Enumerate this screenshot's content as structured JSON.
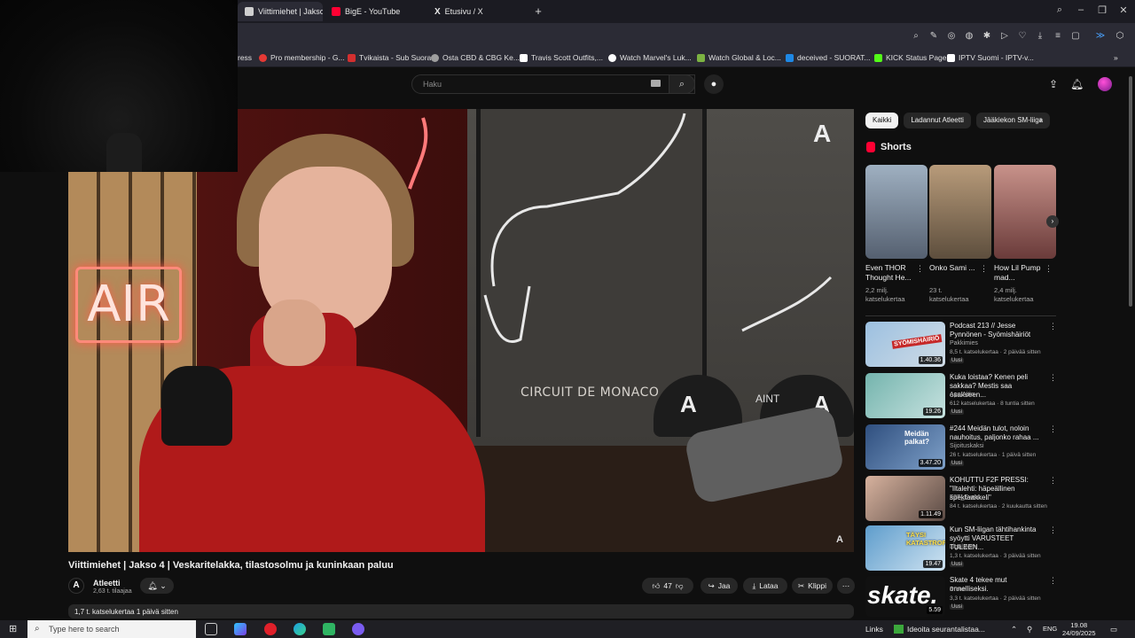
{
  "browser": {
    "tabs": [
      {
        "label": "Viittimiehet | Jakso 4 |",
        "color": "#cccccc"
      },
      {
        "label": "BigE - YouTube",
        "color": "#ff0033"
      },
      {
        "label": "Etusivu / X",
        "color": "#ffffff"
      }
    ],
    "new_tab_label": "+",
    "bookmarks": [
      {
        "label": "ress",
        "color": "#ffffff"
      },
      {
        "label": "Pro membership - G...",
        "color": "#e53935"
      },
      {
        "label": "Tvikaista - Sub Suora",
        "color": "#d32f2f"
      },
      {
        "label": "Osta CBD & CBG Ke...",
        "color": "#9e9e9e"
      },
      {
        "label": "Travis Scott Outfits,...",
        "color": "#ffffff"
      },
      {
        "label": "Watch Marvel's Luk...",
        "color": "#ffffff"
      },
      {
        "label": "Watch Global & Loc...",
        "color": "#7cb342"
      },
      {
        "label": "deceived - SUORAT...",
        "color": "#1e88e5"
      },
      {
        "label": "KICK Status Page",
        "color": "#53fc18"
      },
      {
        "label": "IPTV Suomi - IPTV-v...",
        "color": "#ffffff"
      }
    ]
  },
  "youtube": {
    "search_placeholder": "Haku",
    "video": {
      "title": "Viittimiehet | Jakso 4 | Veskaritelakka, tilastosolmu ja kuninkaan paluu",
      "neon_text": "AIR",
      "poster_text": "CIRCUIT DE MONACO",
      "cap_text": "AINT"
    },
    "channel": {
      "name": "Atleetti",
      "subs": "2,63 t. tilaajaa",
      "logo": "A"
    },
    "actions": {
      "likes": "47",
      "share": "Jaa",
      "download": "Lataa",
      "clip": "Klippi"
    },
    "description_meta": "1,7 t. katselukertaa  1 päivä sitten",
    "chips": [
      "Kaikki",
      "Ladannut Atleetti",
      "Jääkiekon SM-liiga"
    ],
    "shorts_title": "Shorts",
    "shorts": [
      {
        "title": "Even THOR Thought He...",
        "views": "2,2 milj. katselukertaa",
        "bg": "#7d8a9a"
      },
      {
        "title": "Onko Sami ...",
        "views": "23 t. katselukertaa",
        "bg": "#a08a6c"
      },
      {
        "title": "How Lil Pump mad...",
        "views": "2,4 milj. katselukertaa",
        "bg": "#9b6d6a"
      }
    ],
    "recommendations": [
      {
        "title": "Podcast 213 // Jesse Pynnönen - Syömishäiriöt",
        "channel": "Pakkimies",
        "meta": "8,5 t. katselukertaa · 2 päivää sitten",
        "badge": "Uusi",
        "duration": "1.40.36",
        "bg": "#8fb0d0"
      },
      {
        "title": "Kuka loistaa? Kenen peli sakkaa? Mestis saa osakseen...",
        "channel": "Apu Aitio",
        "meta": "612 katselukertaa · 8 tuntia sitten",
        "badge": "Uusi",
        "duration": "19.26",
        "bg": "#6aa6a0"
      },
      {
        "title": "#244 Meidän tulot, noloin nauhoitus, paljonko rahaa ...",
        "channel": "Sijoituskaksi",
        "meta": "26 t. katselukertaa · 1 päivä sitten",
        "badge": "Uusi",
        "duration": "3.47.20",
        "bg": "#4c6e9b"
      },
      {
        "title": "KOHUTTU F2F PRESSI: \"Iltalehti: häpeällinen spektaakkeli\"",
        "channel": "F2F_Event",
        "meta": "84 t. katselukertaa · 2 kuukautta sitten",
        "badge": "",
        "duration": "1.11.49",
        "bg": "#b58e7b"
      },
      {
        "title": "Kun SM-liigan tähtihankinta syöytti VARUSTEET TULEEN...",
        "channel": "Ligal.com",
        "meta": "1,3 t. katselukertaa · 3 päivää sitten",
        "badge": "Uusi",
        "duration": "19.47",
        "bg": "#6aa0c8"
      },
      {
        "title": "Skate 4 tekee mut onnelliseksi.",
        "channel": "Proto",
        "meta": "3,3 t. katselukertaa · 2 päivää sitten",
        "badge": "Uusi",
        "duration": "5.59",
        "bg": "#121212"
      }
    ],
    "rec_thumb_texts": [
      "SYÖMISHÄIRIÖ",
      "",
      "Meidän palkat?",
      "",
      "TÄYSI KATASTROFI",
      "skate."
    ]
  },
  "taskbar": {
    "search_placeholder": "Type here to search",
    "links_label": "Links",
    "notification": "Ideoita seurantalistaa...",
    "language": "ENG",
    "time": "19.08",
    "date": "24/09/2025"
  }
}
